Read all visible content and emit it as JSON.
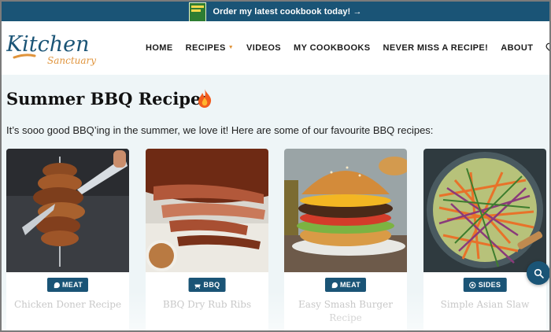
{
  "promo": {
    "text": "Order my latest cookbook today! →"
  },
  "logo": {
    "main_text": "Kitchen",
    "sub_text": "Sanctuary"
  },
  "nav": {
    "items": [
      "HOME",
      "RECIPES",
      "VIDEOS",
      "MY COOKBOOKS",
      "NEVER MISS A RECIPE!",
      "ABOUT"
    ],
    "icons": [
      "heart-icon",
      "search-icon"
    ]
  },
  "page": {
    "title": "Summer BBQ Recipes",
    "title_emoji": "fire-icon",
    "intro": "It’s sooo good BBQ’ing in the summer, we love it! Here are some of our favourite BBQ recipes:"
  },
  "cards": [
    {
      "category": "MEAT",
      "category_icon": "meat-icon",
      "title": "Chicken Doner Recipe"
    },
    {
      "category": "BBQ",
      "category_icon": "bbq-icon",
      "title": "BBQ Dry Rub Ribs"
    },
    {
      "category": "MEAT",
      "category_icon": "meat-icon",
      "title": "Easy Smash Burger Recipe"
    },
    {
      "category": "SIDES",
      "category_icon": "sides-icon",
      "title": "Simple Asian Slaw"
    }
  ],
  "colors": {
    "brand_blue": "#1a5476",
    "accent_orange": "#e0943c",
    "content_bg": "#eef5f7"
  }
}
